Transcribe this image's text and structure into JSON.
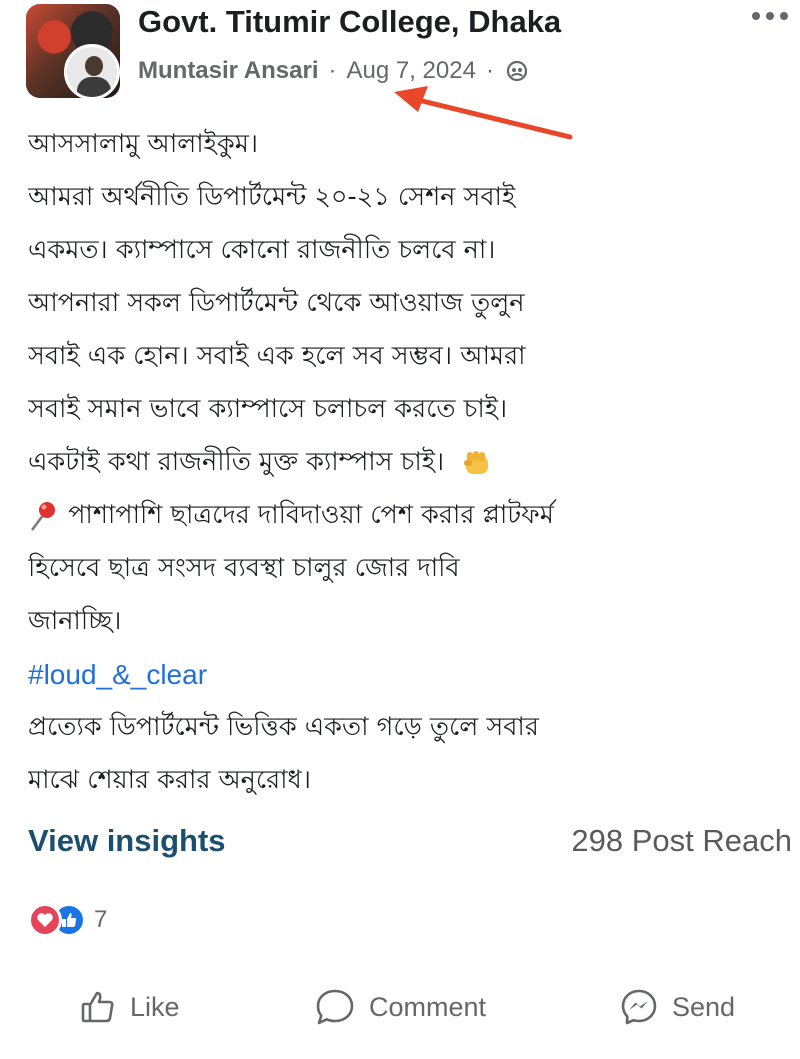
{
  "post": {
    "group_name": "Govt. Titumir College, Dhaka",
    "author": "Muntasir Ansari",
    "separator": "·",
    "date": "Aug 7, 2024",
    "privacy_icon": "members-icon",
    "lines": [
      "আসসালামু আলাইকুম।",
      "আমরা অর্থনীতি ডিপার্টমেন্ট ২০-২১ সেশন সবাই",
      "একমত। ক্যাম্পাসে কোনো রাজনীতি চলবে না।",
      "আপনারা সকল ডিপার্টমেন্ট থেকে আওয়াজ তুলুন",
      "সবাই এক হোন। সবাই এক হলে সব সম্ভব। আমরা",
      "সবাই সমান ভাবে ক্যাম্পাসে চলাচল করতে চাই।",
      "একটাই কথা রাজনীতি মুক্ত ক্যাম্পাস চাই।",
      "পাশাপাশি ছাত্রদের দাবিদাওয়া পেশ করার প্লাটফর্ম",
      "হিসেবে ছাত্র সংসদ  ব্যবস্থা চালুর জোর দাবি",
      "জানাচ্ছি।",
      "#loud_&_clear",
      "প্রত্যেক ডিপার্টমেন্ট ভিত্তিক একতা গড়ে তুলে সবার",
      "মাঝে শেয়ার করার অনুরোধ।"
    ]
  },
  "insights": {
    "view_label": "View insights",
    "reach_label": "298 Post Reach"
  },
  "reactions": {
    "count": "7",
    "types": [
      "love-icon",
      "like-icon"
    ]
  },
  "actions": {
    "like": "Like",
    "comment": "Comment",
    "send": "Send"
  },
  "colors": {
    "hashtag": "#216fdb",
    "insights": "#1c4e6e",
    "annotation_arrow": "#e8472a",
    "love": "#e4455a",
    "like": "#1b74e4"
  }
}
